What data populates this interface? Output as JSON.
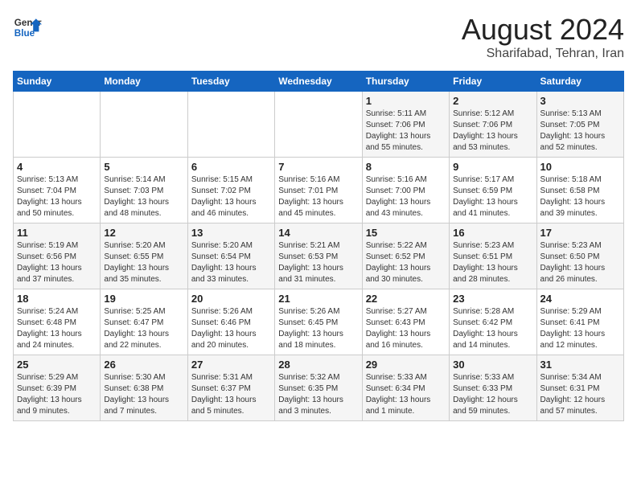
{
  "header": {
    "logo_line1": "General",
    "logo_line2": "Blue",
    "title": "August 2024",
    "subtitle": "Sharifabad, Tehran, Iran"
  },
  "weekdays": [
    "Sunday",
    "Monday",
    "Tuesday",
    "Wednesday",
    "Thursday",
    "Friday",
    "Saturday"
  ],
  "weeks": [
    [
      {
        "day": "",
        "info": ""
      },
      {
        "day": "",
        "info": ""
      },
      {
        "day": "",
        "info": ""
      },
      {
        "day": "",
        "info": ""
      },
      {
        "day": "1",
        "info": "Sunrise: 5:11 AM\nSunset: 7:06 PM\nDaylight: 13 hours\nand 55 minutes."
      },
      {
        "day": "2",
        "info": "Sunrise: 5:12 AM\nSunset: 7:06 PM\nDaylight: 13 hours\nand 53 minutes."
      },
      {
        "day": "3",
        "info": "Sunrise: 5:13 AM\nSunset: 7:05 PM\nDaylight: 13 hours\nand 52 minutes."
      }
    ],
    [
      {
        "day": "4",
        "info": "Sunrise: 5:13 AM\nSunset: 7:04 PM\nDaylight: 13 hours\nand 50 minutes."
      },
      {
        "day": "5",
        "info": "Sunrise: 5:14 AM\nSunset: 7:03 PM\nDaylight: 13 hours\nand 48 minutes."
      },
      {
        "day": "6",
        "info": "Sunrise: 5:15 AM\nSunset: 7:02 PM\nDaylight: 13 hours\nand 46 minutes."
      },
      {
        "day": "7",
        "info": "Sunrise: 5:16 AM\nSunset: 7:01 PM\nDaylight: 13 hours\nand 45 minutes."
      },
      {
        "day": "8",
        "info": "Sunrise: 5:16 AM\nSunset: 7:00 PM\nDaylight: 13 hours\nand 43 minutes."
      },
      {
        "day": "9",
        "info": "Sunrise: 5:17 AM\nSunset: 6:59 PM\nDaylight: 13 hours\nand 41 minutes."
      },
      {
        "day": "10",
        "info": "Sunrise: 5:18 AM\nSunset: 6:58 PM\nDaylight: 13 hours\nand 39 minutes."
      }
    ],
    [
      {
        "day": "11",
        "info": "Sunrise: 5:19 AM\nSunset: 6:56 PM\nDaylight: 13 hours\nand 37 minutes."
      },
      {
        "day": "12",
        "info": "Sunrise: 5:20 AM\nSunset: 6:55 PM\nDaylight: 13 hours\nand 35 minutes."
      },
      {
        "day": "13",
        "info": "Sunrise: 5:20 AM\nSunset: 6:54 PM\nDaylight: 13 hours\nand 33 minutes."
      },
      {
        "day": "14",
        "info": "Sunrise: 5:21 AM\nSunset: 6:53 PM\nDaylight: 13 hours\nand 31 minutes."
      },
      {
        "day": "15",
        "info": "Sunrise: 5:22 AM\nSunset: 6:52 PM\nDaylight: 13 hours\nand 30 minutes."
      },
      {
        "day": "16",
        "info": "Sunrise: 5:23 AM\nSunset: 6:51 PM\nDaylight: 13 hours\nand 28 minutes."
      },
      {
        "day": "17",
        "info": "Sunrise: 5:23 AM\nSunset: 6:50 PM\nDaylight: 13 hours\nand 26 minutes."
      }
    ],
    [
      {
        "day": "18",
        "info": "Sunrise: 5:24 AM\nSunset: 6:48 PM\nDaylight: 13 hours\nand 24 minutes."
      },
      {
        "day": "19",
        "info": "Sunrise: 5:25 AM\nSunset: 6:47 PM\nDaylight: 13 hours\nand 22 minutes."
      },
      {
        "day": "20",
        "info": "Sunrise: 5:26 AM\nSunset: 6:46 PM\nDaylight: 13 hours\nand 20 minutes."
      },
      {
        "day": "21",
        "info": "Sunrise: 5:26 AM\nSunset: 6:45 PM\nDaylight: 13 hours\nand 18 minutes."
      },
      {
        "day": "22",
        "info": "Sunrise: 5:27 AM\nSunset: 6:43 PM\nDaylight: 13 hours\nand 16 minutes."
      },
      {
        "day": "23",
        "info": "Sunrise: 5:28 AM\nSunset: 6:42 PM\nDaylight: 13 hours\nand 14 minutes."
      },
      {
        "day": "24",
        "info": "Sunrise: 5:29 AM\nSunset: 6:41 PM\nDaylight: 13 hours\nand 12 minutes."
      }
    ],
    [
      {
        "day": "25",
        "info": "Sunrise: 5:29 AM\nSunset: 6:39 PM\nDaylight: 13 hours\nand 9 minutes."
      },
      {
        "day": "26",
        "info": "Sunrise: 5:30 AM\nSunset: 6:38 PM\nDaylight: 13 hours\nand 7 minutes."
      },
      {
        "day": "27",
        "info": "Sunrise: 5:31 AM\nSunset: 6:37 PM\nDaylight: 13 hours\nand 5 minutes."
      },
      {
        "day": "28",
        "info": "Sunrise: 5:32 AM\nSunset: 6:35 PM\nDaylight: 13 hours\nand 3 minutes."
      },
      {
        "day": "29",
        "info": "Sunrise: 5:33 AM\nSunset: 6:34 PM\nDaylight: 13 hours\nand 1 minute."
      },
      {
        "day": "30",
        "info": "Sunrise: 5:33 AM\nSunset: 6:33 PM\nDaylight: 12 hours\nand 59 minutes."
      },
      {
        "day": "31",
        "info": "Sunrise: 5:34 AM\nSunset: 6:31 PM\nDaylight: 12 hours\nand 57 minutes."
      }
    ]
  ]
}
